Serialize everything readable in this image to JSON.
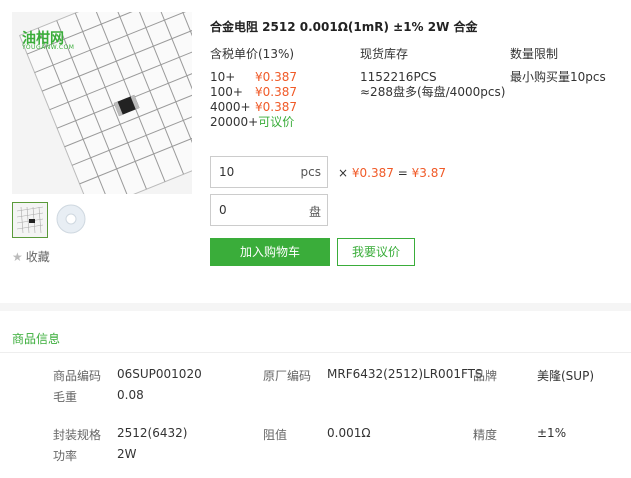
{
  "product": {
    "title": "合金电阻 2512 0.001Ω(1mR) ±1% 2W 合金",
    "logo_text": "油柑网",
    "logo_sub": "YOUGANW.COM",
    "favorite_label": "收藏"
  },
  "pricing": {
    "headers": {
      "price": "含税单价(13%)",
      "stock": "现货库存",
      "limit": "数量限制"
    },
    "tiers": [
      {
        "qty": "10+",
        "price": "¥0.387"
      },
      {
        "qty": "100+",
        "price": "¥0.387"
      },
      {
        "qty": "4000+",
        "price": "¥0.387"
      },
      {
        "qty": "20000+",
        "price": "可议价"
      }
    ],
    "stock_pcs": "1152216PCS",
    "stock_reels": "≈288盘多(每盘/4000pcs)",
    "limit_text": "最小购买量10pcs"
  },
  "order": {
    "pcs_value": "10",
    "pcs_unit": "pcs",
    "reel_value": "0",
    "reel_unit": "盘",
    "times": "×",
    "unit_price": "¥0.387",
    "equals": "=",
    "total": "¥3.87",
    "add_to_cart": "加入购物车",
    "request_quote": "我要议价"
  },
  "info": {
    "section_title": "商品信息",
    "rows": [
      {
        "k1": "商品编码",
        "v1": "06SUP001020",
        "k2": "原厂编码",
        "v2": "MRF6432(2512)LR001FTS",
        "k3": "品牌",
        "v3": "美隆(SUP)"
      },
      {
        "k1": "毛重",
        "v1": "0.08"
      },
      {
        "k1": "封装规格",
        "v1": "2512(6432)",
        "k2": "阻值",
        "v2": "0.001Ω",
        "k3": "精度",
        "v3": "±1%"
      },
      {
        "k1": "功率",
        "v1": "2W"
      }
    ]
  },
  "colors": {
    "accent": "#3aad3a",
    "price": "#f05a28"
  }
}
